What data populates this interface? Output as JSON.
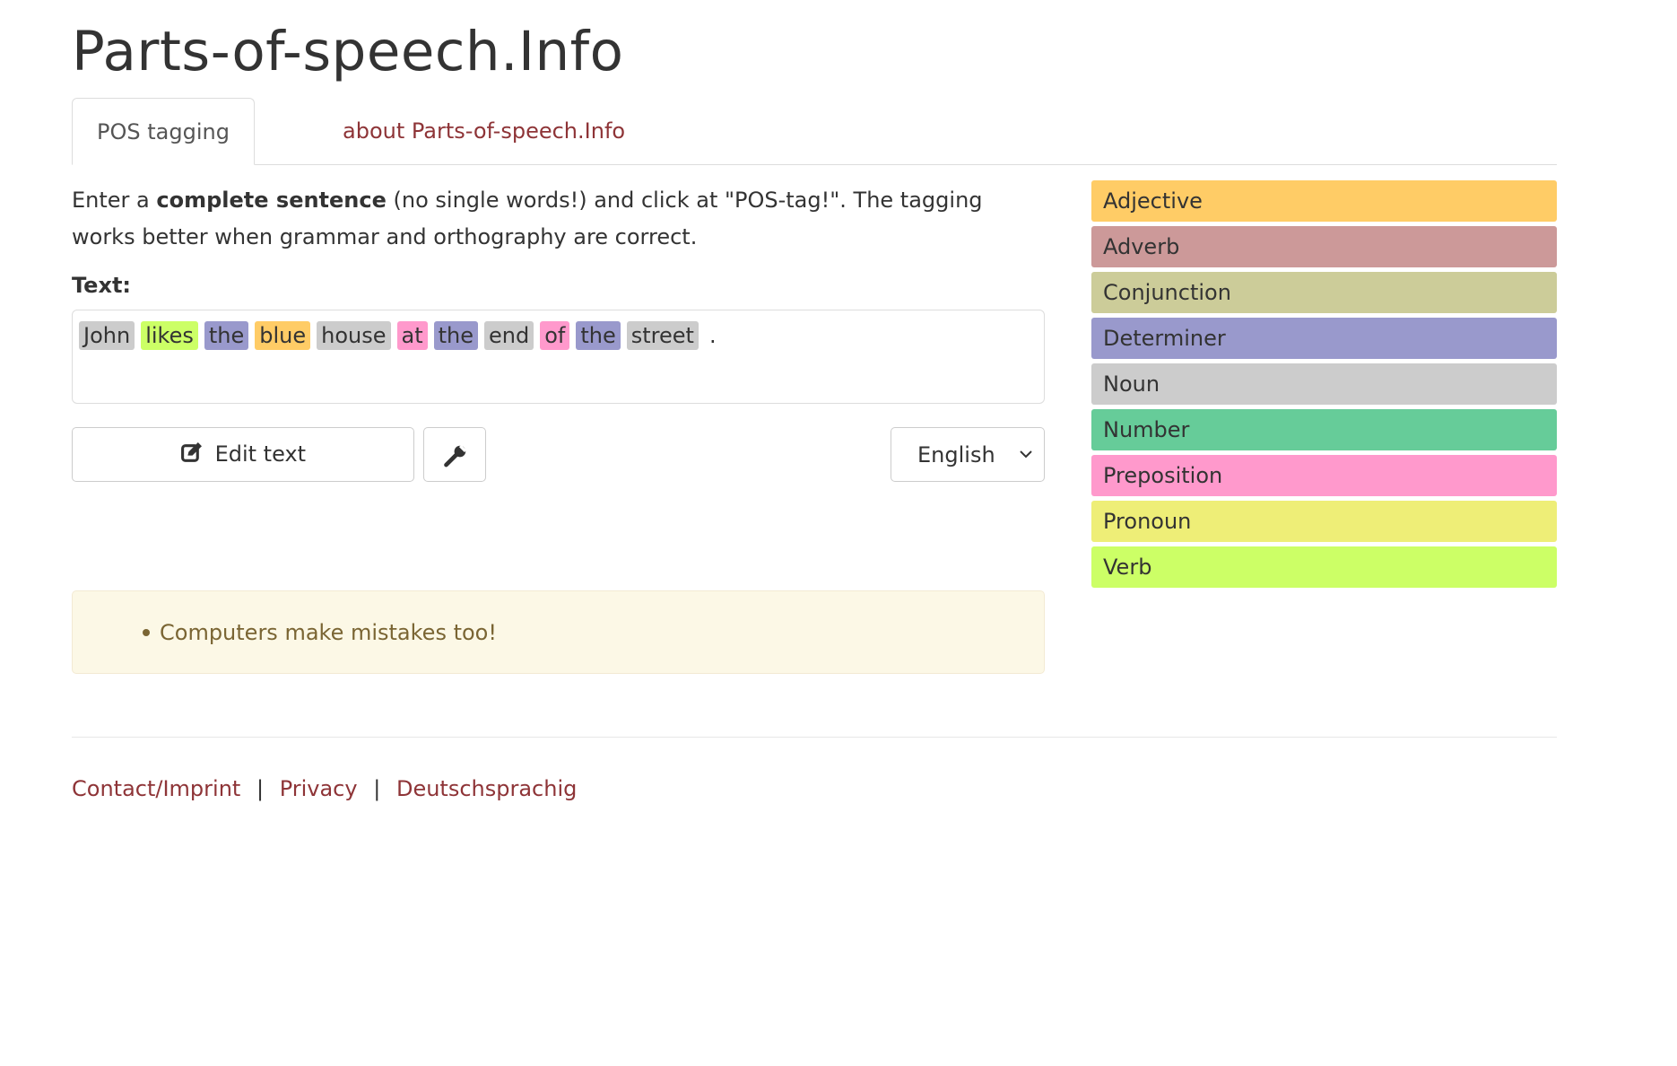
{
  "site": {
    "title": "Parts-of-speech.Info"
  },
  "tabs": [
    {
      "label": "POS tagging",
      "active": true
    },
    {
      "label": "about Parts-of-speech.Info",
      "active": false
    }
  ],
  "intro": {
    "text_before": "Enter a ",
    "bold": "complete sentence",
    "text_after": " (no single words!) and click at \"POS-tag!\". The tagging works better when grammar and orthography are correct."
  },
  "text_label": "Text:",
  "tagged_words": [
    {
      "word": "John",
      "pos": "Noun",
      "color": "#cccccc"
    },
    {
      "word": "likes",
      "pos": "Verb",
      "color": "#ccff66"
    },
    {
      "word": "the",
      "pos": "Determiner",
      "color": "#9999cc"
    },
    {
      "word": "blue",
      "pos": "Adjective",
      "color": "#ffcc66"
    },
    {
      "word": "house",
      "pos": "Noun",
      "color": "#cccccc"
    },
    {
      "word": "at",
      "pos": "Preposition",
      "color": "#ff99cc"
    },
    {
      "word": "the",
      "pos": "Determiner",
      "color": "#9999cc"
    },
    {
      "word": "end",
      "pos": "Noun",
      "color": "#cccccc"
    },
    {
      "word": "of",
      "pos": "Preposition",
      "color": "#ff99cc"
    },
    {
      "word": "the",
      "pos": "Determiner",
      "color": "#9999cc"
    },
    {
      "word": "street",
      "pos": "Noun",
      "color": "#cccccc"
    },
    {
      "word": ".",
      "pos": "",
      "color": "transparent"
    }
  ],
  "buttons": {
    "edit_text": "Edit text",
    "edit_icon": "edit-icon",
    "settings_icon": "wrench-icon"
  },
  "language": {
    "selected": "English"
  },
  "notice": {
    "items": [
      "Computers make mistakes too!"
    ]
  },
  "legend": [
    {
      "label": "Adjective",
      "color": "#ffcc66"
    },
    {
      "label": "Adverb",
      "color": "#cc9999"
    },
    {
      "label": "Conjunction",
      "color": "#cccc99"
    },
    {
      "label": "Determiner",
      "color": "#9999cc"
    },
    {
      "label": "Noun",
      "color": "#cccccc"
    },
    {
      "label": "Number",
      "color": "#66cc99"
    },
    {
      "label": "Preposition",
      "color": "#ff99cc"
    },
    {
      "label": "Pronoun",
      "color": "#eeee77"
    },
    {
      "label": "Verb",
      "color": "#ccff66"
    }
  ],
  "footer": {
    "links": [
      "Contact/Imprint",
      "Privacy",
      "Deutschsprachig"
    ],
    "separator": "|"
  },
  "colors": {
    "brand_link": "#8e3437",
    "text": "#333333",
    "notice_background": "#fcf8e6",
    "notice_text": "#7a6533"
  }
}
